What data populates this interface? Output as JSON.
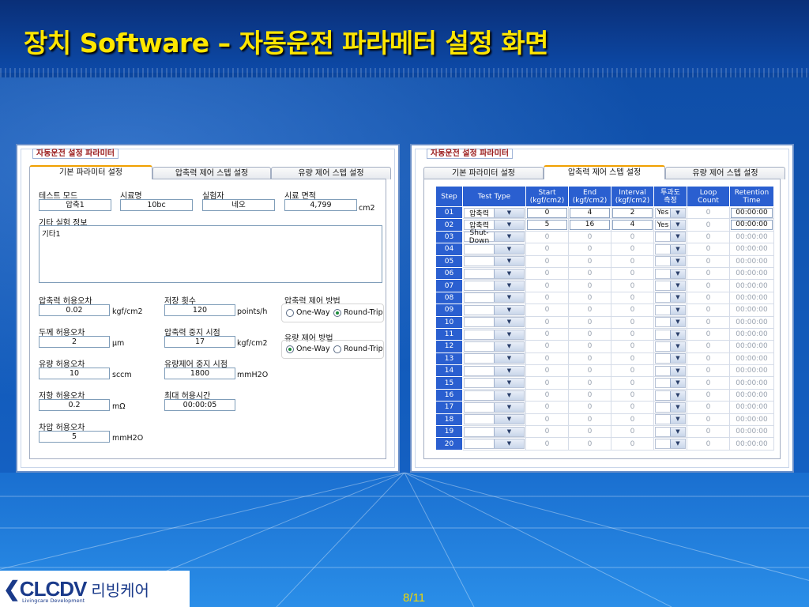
{
  "slide": {
    "title": "장치 Software – 자동운전 파라메터 설정 화면",
    "page_number": "8/11",
    "logo_text": "CLCDV",
    "logo_subtitle": "Livingcare Development",
    "logo_korean": "리빙케어"
  },
  "left_window": {
    "title": "자동운전 설정 파라미터",
    "tabs": [
      {
        "label": "기본 파라미터 설정",
        "active": true
      },
      {
        "label": "압축력 제어 스텝 설정",
        "active": false
      },
      {
        "label": "유량 제어 스텝 설정",
        "active": false
      }
    ],
    "basic": {
      "test_mode": {
        "label": "테스트 모드",
        "value": "압축1"
      },
      "sample_name": {
        "label": "시료명",
        "value": "10bc"
      },
      "tester": {
        "label": "실험자",
        "value": "네오"
      },
      "sample_area": {
        "label": "시료 면적",
        "value": "4,799",
        "unit": "cm2"
      },
      "other_info": {
        "label": "기타 실험 정보",
        "value": "기타1"
      }
    },
    "tolerances": {
      "pressure_tol": {
        "label": "압축력 허용오차",
        "value": "0.02",
        "unit": "kgf/cm2"
      },
      "thickness_tol": {
        "label": "두께 허용오차",
        "value": "2",
        "unit": "μm"
      },
      "flow_tol": {
        "label": "유량 허용오차",
        "value": "10",
        "unit": "sccm"
      },
      "resistance_tol": {
        "label": "저항 허용오차",
        "value": "0.2",
        "unit": "mΩ"
      },
      "diffpressure_tol": {
        "label": "차압 허용오차",
        "value": "5",
        "unit": "mmH2O"
      }
    },
    "params": {
      "save_count": {
        "label": "저장 횟수",
        "value": "120",
        "unit": "points/h"
      },
      "pressure_stop": {
        "label": "압축력 중지 시점",
        "value": "17",
        "unit": "kgf/cm2"
      },
      "flow_stop": {
        "label": "유량제어 중지 시점",
        "value": "1800",
        "unit": "mmH2O"
      },
      "max_time": {
        "label": "최대 허용시간",
        "value": "00:00:05"
      }
    },
    "pressure_method": {
      "label": "압축력 제어 방법",
      "opt1": "One-Way",
      "opt2": "Round-Trip",
      "selected": "Round-Trip"
    },
    "flow_method": {
      "label": "유량 제어 방법",
      "opt1": "One-Way",
      "opt2": "Round-Trip",
      "selected": "One-Way"
    }
  },
  "right_window": {
    "title": "자동운전 설정 파라미터",
    "tabs": [
      {
        "label": "기본 파라미터 설정",
        "active": false
      },
      {
        "label": "압축력 제어 스텝 설정",
        "active": true
      },
      {
        "label": "유량 제어 스텝 설정",
        "active": false
      }
    ],
    "columns": [
      "Step",
      "Test Type",
      "Start\n(kgf/cm2)",
      "End\n(kgf/cm2)",
      "Interval\n(kgf/cm2)",
      "투과도\n측정",
      "Loop\nCount",
      "Retention\nTime"
    ],
    "rows": [
      {
        "step": "01",
        "type": "압축력",
        "start": "0",
        "end": "4",
        "interval": "2",
        "perm": "Yes",
        "loop": "0",
        "time": "00:00:00",
        "enabled": true
      },
      {
        "step": "02",
        "type": "압축력",
        "start": "5",
        "end": "16",
        "interval": "4",
        "perm": "Yes",
        "loop": "0",
        "time": "00:00:00",
        "enabled": true
      },
      {
        "step": "03",
        "type": "Shut-Down",
        "start": "0",
        "end": "0",
        "interval": "0",
        "perm": "",
        "loop": "0",
        "time": "00:00:00",
        "enabled": false
      },
      {
        "step": "04",
        "type": "",
        "start": "0",
        "end": "0",
        "interval": "0",
        "perm": "",
        "loop": "0",
        "time": "00:00:00",
        "enabled": false
      },
      {
        "step": "05",
        "type": "",
        "start": "0",
        "end": "0",
        "interval": "0",
        "perm": "",
        "loop": "0",
        "time": "00:00:00",
        "enabled": false
      },
      {
        "step": "06",
        "type": "",
        "start": "0",
        "end": "0",
        "interval": "0",
        "perm": "",
        "loop": "0",
        "time": "00:00:00",
        "enabled": false
      },
      {
        "step": "07",
        "type": "",
        "start": "0",
        "end": "0",
        "interval": "0",
        "perm": "",
        "loop": "0",
        "time": "00:00:00",
        "enabled": false
      },
      {
        "step": "08",
        "type": "",
        "start": "0",
        "end": "0",
        "interval": "0",
        "perm": "",
        "loop": "0",
        "time": "00:00:00",
        "enabled": false
      },
      {
        "step": "09",
        "type": "",
        "start": "0",
        "end": "0",
        "interval": "0",
        "perm": "",
        "loop": "0",
        "time": "00:00:00",
        "enabled": false
      },
      {
        "step": "10",
        "type": "",
        "start": "0",
        "end": "0",
        "interval": "0",
        "perm": "",
        "loop": "0",
        "time": "00:00:00",
        "enabled": false
      },
      {
        "step": "11",
        "type": "",
        "start": "0",
        "end": "0",
        "interval": "0",
        "perm": "",
        "loop": "0",
        "time": "00:00:00",
        "enabled": false
      },
      {
        "step": "12",
        "type": "",
        "start": "0",
        "end": "0",
        "interval": "0",
        "perm": "",
        "loop": "0",
        "time": "00:00:00",
        "enabled": false
      },
      {
        "step": "13",
        "type": "",
        "start": "0",
        "end": "0",
        "interval": "0",
        "perm": "",
        "loop": "0",
        "time": "00:00:00",
        "enabled": false
      },
      {
        "step": "14",
        "type": "",
        "start": "0",
        "end": "0",
        "interval": "0",
        "perm": "",
        "loop": "0",
        "time": "00:00:00",
        "enabled": false
      },
      {
        "step": "15",
        "type": "",
        "start": "0",
        "end": "0",
        "interval": "0",
        "perm": "",
        "loop": "0",
        "time": "00:00:00",
        "enabled": false
      },
      {
        "step": "16",
        "type": "",
        "start": "0",
        "end": "0",
        "interval": "0",
        "perm": "",
        "loop": "0",
        "time": "00:00:00",
        "enabled": false
      },
      {
        "step": "17",
        "type": "",
        "start": "0",
        "end": "0",
        "interval": "0",
        "perm": "",
        "loop": "0",
        "time": "00:00:00",
        "enabled": false
      },
      {
        "step": "18",
        "type": "",
        "start": "0",
        "end": "0",
        "interval": "0",
        "perm": "",
        "loop": "0",
        "time": "00:00:00",
        "enabled": false
      },
      {
        "step": "19",
        "type": "",
        "start": "0",
        "end": "0",
        "interval": "0",
        "perm": "",
        "loop": "0",
        "time": "00:00:00",
        "enabled": false
      },
      {
        "step": "20",
        "type": "",
        "start": "0",
        "end": "0",
        "interval": "0",
        "perm": "",
        "loop": "0",
        "time": "00:00:00",
        "enabled": false
      }
    ]
  },
  "colors": {
    "title_yellow": "#ffe600",
    "header_blue": "#2a5fd0",
    "active_tab_accent": "#f0a000",
    "page_number": "#f2d800"
  }
}
